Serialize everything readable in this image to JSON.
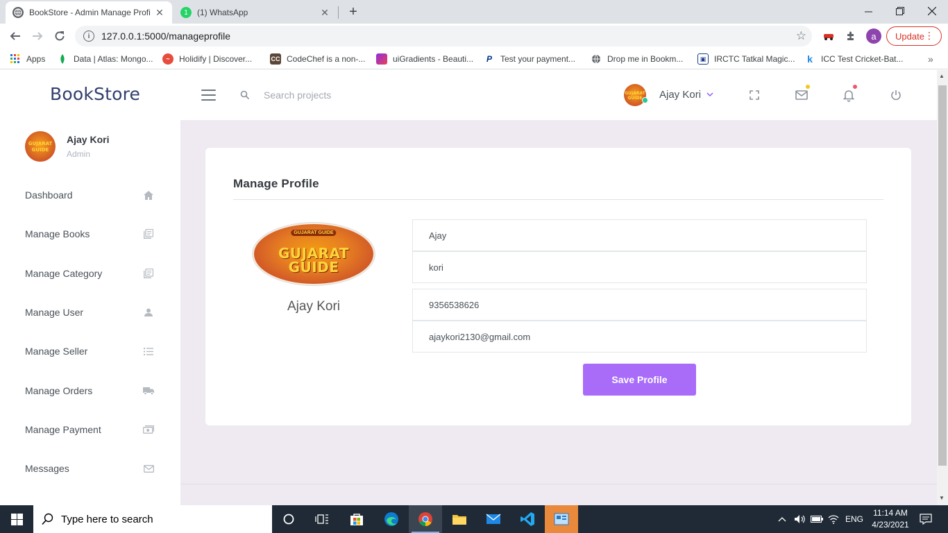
{
  "browser": {
    "tabs": [
      {
        "title": "BookStore - Admin Manage Profi",
        "active": true
      },
      {
        "title": "(1) WhatsApp",
        "active": false
      }
    ],
    "url": "127.0.0.1:5000/manageprofile",
    "update_label": "Update",
    "profile_initial": "a",
    "bookmarks": [
      {
        "label": "Apps",
        "icon": "apps-grid-icon"
      },
      {
        "label": "Data | Atlas: Mongo...",
        "icon": "mongodb-leaf-icon"
      },
      {
        "label": "Holidify | Discover...",
        "icon": "holidify-icon"
      },
      {
        "label": "CodeChef is a non-...",
        "icon": "codechef-icon"
      },
      {
        "label": "uiGradients - Beauti...",
        "icon": "uigradients-icon"
      },
      {
        "label": "Test your payment...",
        "icon": "paypal-icon"
      },
      {
        "label": "Drop me in Bookm...",
        "icon": "globe-icon"
      },
      {
        "label": "IRCTC Tatkal Magic...",
        "icon": "train-icon"
      },
      {
        "label": "ICC Test Cricket-Bat...",
        "icon": "k-icon"
      }
    ]
  },
  "app": {
    "brand": "BookStore",
    "search_placeholder": "Search projects",
    "header_user": "Ajay Kori",
    "colors": {
      "accent": "#a86cf9",
      "brand": "#2f3e6e",
      "page_bg": "#efeaf1"
    }
  },
  "sidebar": {
    "user_name": "Ajay Kori",
    "user_role": "Admin",
    "items": [
      {
        "label": "Dashboard",
        "icon": "home-icon"
      },
      {
        "label": "Manage Books",
        "icon": "books-icon"
      },
      {
        "label": "Manage Category",
        "icon": "category-icon"
      },
      {
        "label": "Manage User",
        "icon": "user-icon"
      },
      {
        "label": "Manage Seller",
        "icon": "list-icon"
      },
      {
        "label": "Manage Orders",
        "icon": "truck-icon"
      },
      {
        "label": "Manage Payment",
        "icon": "money-icon"
      },
      {
        "label": "Messages",
        "icon": "mail-icon"
      }
    ]
  },
  "profile": {
    "title": "Manage Profile",
    "logo_small": "GUJARAT GUIDE",
    "logo_line1": "GUJARAT",
    "logo_line2": "GUIDE",
    "display_name": "Ajay Kori",
    "first_name": "Ajay",
    "last_name": "kori",
    "phone": "9356538626",
    "email": "ajaykori2130@gmail.com",
    "save_label": "Save Profile"
  },
  "taskbar": {
    "search_placeholder": "Type here to search",
    "language": "ENG",
    "time": "11:14 AM",
    "date": "4/23/2021"
  }
}
